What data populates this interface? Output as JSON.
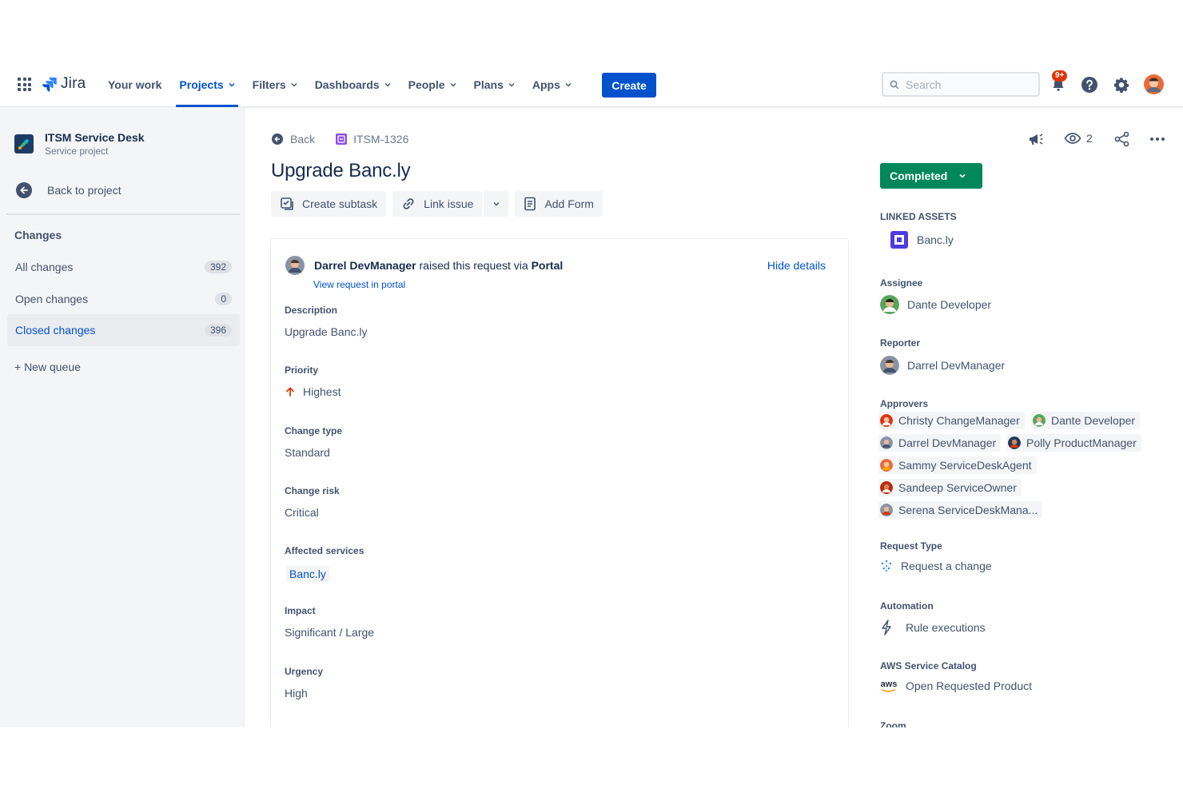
{
  "nav": {
    "product": "Jira",
    "items": [
      {
        "label": "Your work",
        "dropdown": false
      },
      {
        "label": "Projects",
        "dropdown": true,
        "active": true
      },
      {
        "label": "Filters",
        "dropdown": true
      },
      {
        "label": "Dashboards",
        "dropdown": true
      },
      {
        "label": "People",
        "dropdown": true
      },
      {
        "label": "Plans",
        "dropdown": true
      },
      {
        "label": "Apps",
        "dropdown": true
      }
    ],
    "create_label": "Create",
    "search_placeholder": "Search",
    "notifications_badge": "9+",
    "accent": "#0052CC"
  },
  "sidebar": {
    "project_name": "ITSM Service Desk",
    "project_type": "Service project",
    "back_label": "Back to project",
    "section": "Changes",
    "queues": [
      {
        "label": "All changes",
        "count": "392"
      },
      {
        "label": "Open changes",
        "count": "0"
      },
      {
        "label": "Closed changes",
        "count": "396",
        "selected": true
      }
    ],
    "new_queue": "+ New queue"
  },
  "issue": {
    "back_label": "Back",
    "key": "ITSM-1326",
    "title": "Upgrade Banc.ly",
    "actions": {
      "create_subtask": "Create subtask",
      "link_issue": "Link issue",
      "add_form": "Add Form"
    },
    "raised_by": "Darrel DevManager",
    "raised_text": "raised this request via",
    "channel": "Portal",
    "view_portal": "View request in portal",
    "hide_details": "Hide details",
    "fields": {
      "description": {
        "label": "Description",
        "value": "Upgrade Banc.ly"
      },
      "priority": {
        "label": "Priority",
        "value": "Highest"
      },
      "change_type": {
        "label": "Change type",
        "value": "Standard"
      },
      "change_risk": {
        "label": "Change risk",
        "value": "Critical"
      },
      "affected_services": {
        "label": "Affected services",
        "value": "Banc.ly"
      },
      "impact": {
        "label": "Impact",
        "value": "Significant / Large"
      },
      "urgency": {
        "label": "Urgency",
        "value": "High"
      }
    }
  },
  "details": {
    "watchers": "2",
    "status": "Completed",
    "status_color": "#00875A",
    "linked_assets_label": "LINKED ASSETS",
    "linked_asset": "Banc.ly",
    "assignee_label": "Assignee",
    "assignee": "Dante Developer",
    "reporter_label": "Reporter",
    "reporter": "Darrel DevManager",
    "approvers_label": "Approvers",
    "approvers": [
      "Christy ChangeManager",
      "Dante Developer",
      "Darrel DevManager",
      "Polly ProductManager",
      "Sammy ServiceDeskAgent",
      "Sandeep ServiceOwner",
      "Serena ServiceDeskMana..."
    ],
    "request_type_label": "Request Type",
    "request_type": "Request a change",
    "automation_label": "Automation",
    "automation": "Rule executions",
    "aws_label": "AWS Service Catalog",
    "aws_icon_text": "aws",
    "aws_value": "Open Requested Product",
    "zoom_label": "Zoom"
  }
}
